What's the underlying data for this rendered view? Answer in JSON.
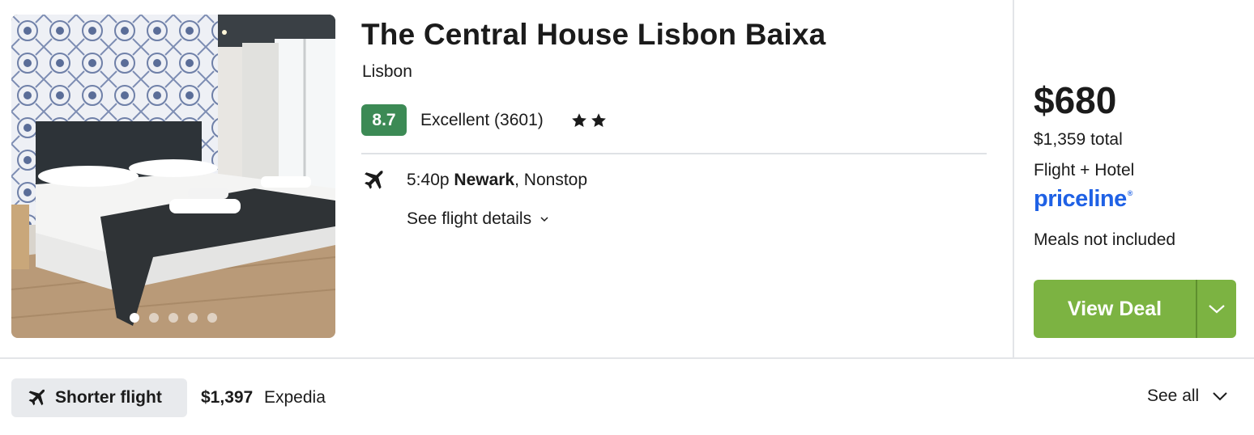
{
  "hotel": {
    "name": "The Central House Lisbon Baixa",
    "city": "Lisbon",
    "score": "8.7",
    "rating_text": "Excellent (3601)",
    "star_count": 2,
    "photo_count": 5,
    "active_photo": 1
  },
  "flight": {
    "time": "5:40p",
    "origin": "Newark",
    "stops": ", Nonstop",
    "details_label": "See flight details"
  },
  "pricing": {
    "price": "$680",
    "total": "$1,359 total",
    "package": "Flight + Hotel",
    "provider": "priceline",
    "meals": "Meals not included",
    "cta_label": "View Deal"
  },
  "alternative": {
    "tag_label": "Shorter flight",
    "price": "$1,397",
    "provider": "Expedia",
    "see_all_label": "See all"
  },
  "colors": {
    "score_bg": "#3c8a55",
    "cta_bg": "#7cb342",
    "provider_blue": "#1f61e5",
    "tag_bg": "#e8eaed"
  },
  "icons": {
    "flight": "plane-icon",
    "details": "chevron-down-icon",
    "star": "star-icon",
    "cta_dropdown": "chevron-down-icon"
  }
}
